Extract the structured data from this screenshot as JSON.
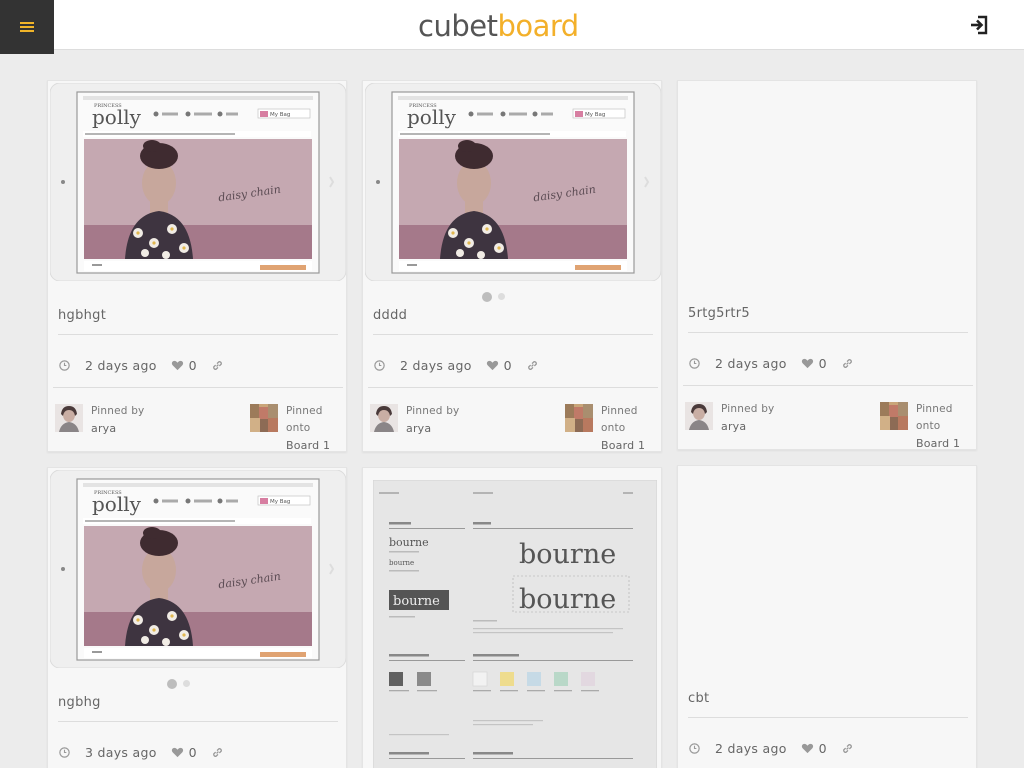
{
  "header": {
    "logo_part1": "cubet",
    "logo_part2": "board",
    "menu_icon": "hamburger-menu-icon",
    "signin_icon": "sign-in-icon",
    "brand_color": "#f3b02a"
  },
  "cards": [
    {
      "title": "hgbhgt",
      "time": "2 days ago",
      "likes": "0",
      "pinned_by_label": "Pinned by",
      "pinned_by": "arya",
      "pinned_onto_label": "Pinned onto",
      "board": "Board 1"
    },
    {
      "title": "dddd",
      "time": "2 days ago",
      "likes": "0",
      "pinned_by_label": "Pinned by",
      "pinned_by": "arya",
      "pinned_onto_label": "Pinned onto",
      "board": "Board 1"
    },
    {
      "title": "5rtg5rtr5",
      "time": "2 days ago",
      "likes": "0",
      "pinned_by_label": "Pinned by",
      "pinned_by": "arya",
      "pinned_onto_label": "Pinned onto",
      "board": "Board 1"
    },
    {
      "title": "ngbhg",
      "time": "3 days ago",
      "likes": "0"
    },
    {
      "image_text": "bourne"
    },
    {
      "title": "cbt",
      "time": "2 days ago",
      "likes": "0"
    }
  ],
  "site_preview": {
    "brand_small": "PRINCESS",
    "brand_big": "polly",
    "bag_label": "My Bag",
    "hero_text": "daisy chain"
  }
}
